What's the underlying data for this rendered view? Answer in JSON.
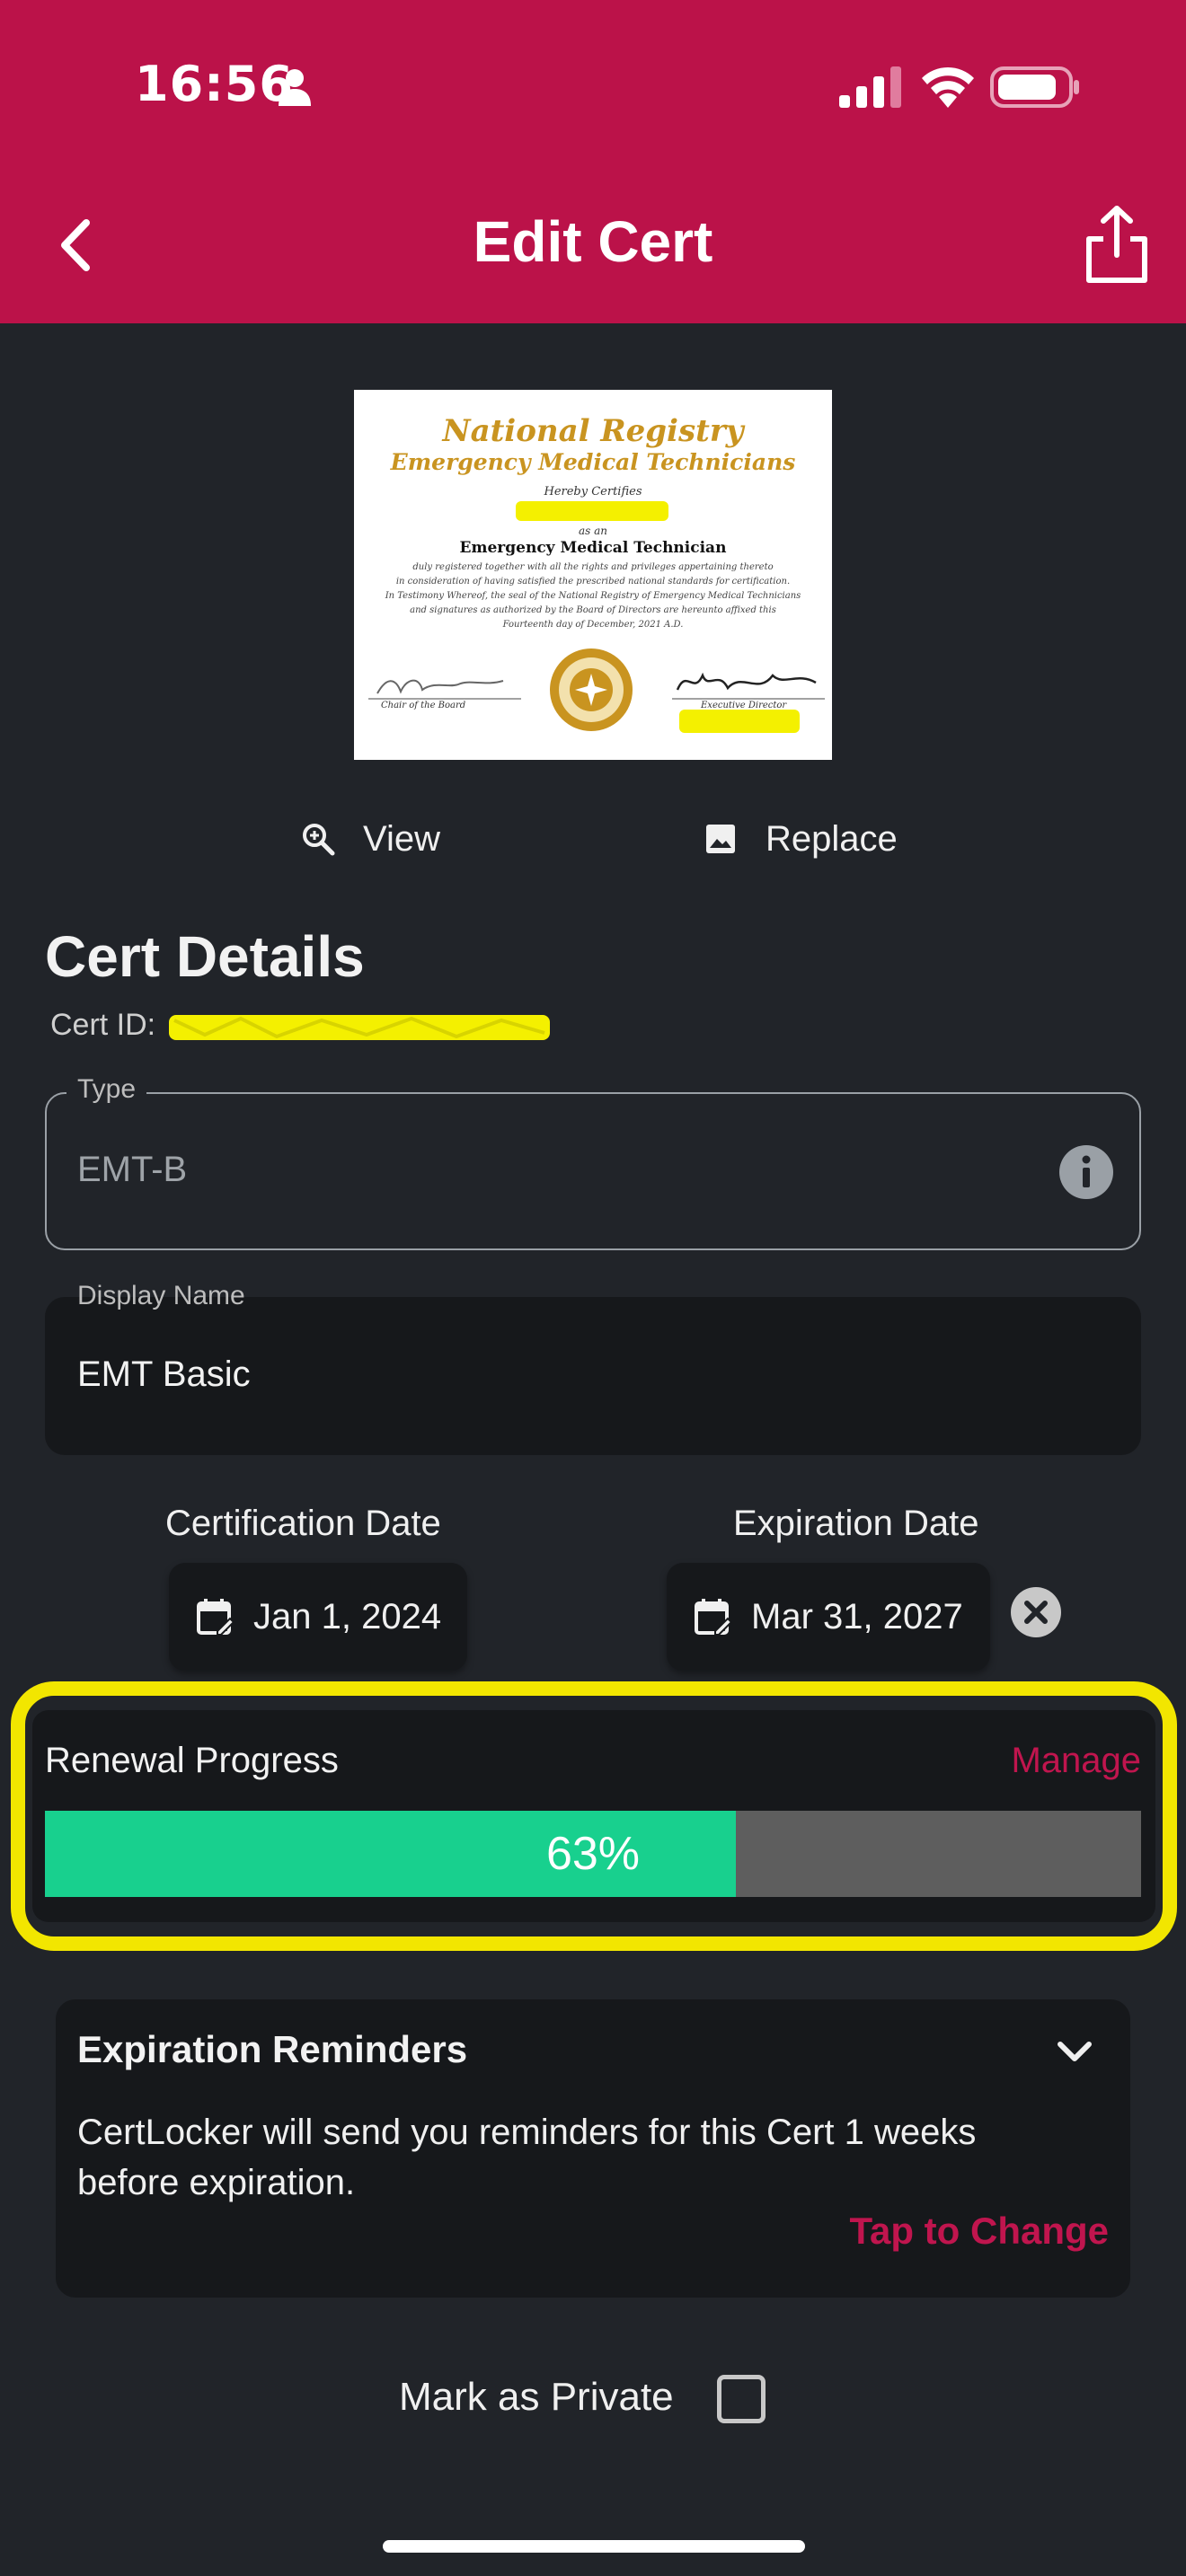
{
  "status_bar": {
    "time": "16:56"
  },
  "header": {
    "title": "Edit Cert"
  },
  "certificate_image": {
    "line1": "National Registry",
    "line2": "Emergency Medical Technicians",
    "line3": "Hereby Certifies",
    "line4": "as an",
    "line5": "Emergency Medical Technician",
    "body1": "duly registered together with all the rights and privileges appertaining thereto",
    "body2": "in consideration of having satisfied the prescribed national standards for certification.",
    "body3": "In Testimony Whereof, the seal of the National Registry of Emergency Medical Technicians",
    "body4": "and signatures as authorized by the Board of Directors are hereunto affixed this",
    "body5": "Fourteenth day of December, 2021 A.D.",
    "sig_left": "Chair of the Board",
    "sig_right": "Executive Director"
  },
  "actions": {
    "view": "View",
    "replace": "Replace"
  },
  "details": {
    "title": "Cert Details",
    "cert_id_label": "Cert ID:"
  },
  "type_field": {
    "label": "Type",
    "value": "EMT-B"
  },
  "display_name_field": {
    "label": "Display Name",
    "value": "EMT Basic"
  },
  "dates": {
    "certification_label": "Certification Date",
    "certification_value": "Jan 1, 2024",
    "expiration_label": "Expiration Date",
    "expiration_value": "Mar 31, 2027"
  },
  "renewal": {
    "label": "Renewal Progress",
    "manage": "Manage",
    "progress_percent": 63,
    "progress_text": "63%"
  },
  "reminders": {
    "title": "Expiration Reminders",
    "text": "CertLocker will send you reminders for this Cert 1 weeks before expiration.",
    "action": "Tap to Change"
  },
  "private": {
    "label": "Mark as Private",
    "checked": false
  },
  "colors": {
    "header_bg": "#bb1249",
    "page_bg": "#212429",
    "accent_link": "#c0154e",
    "progress_fill": "#18d08e",
    "progress_track": "#5e5e5e",
    "highlight": "#f2e600"
  }
}
